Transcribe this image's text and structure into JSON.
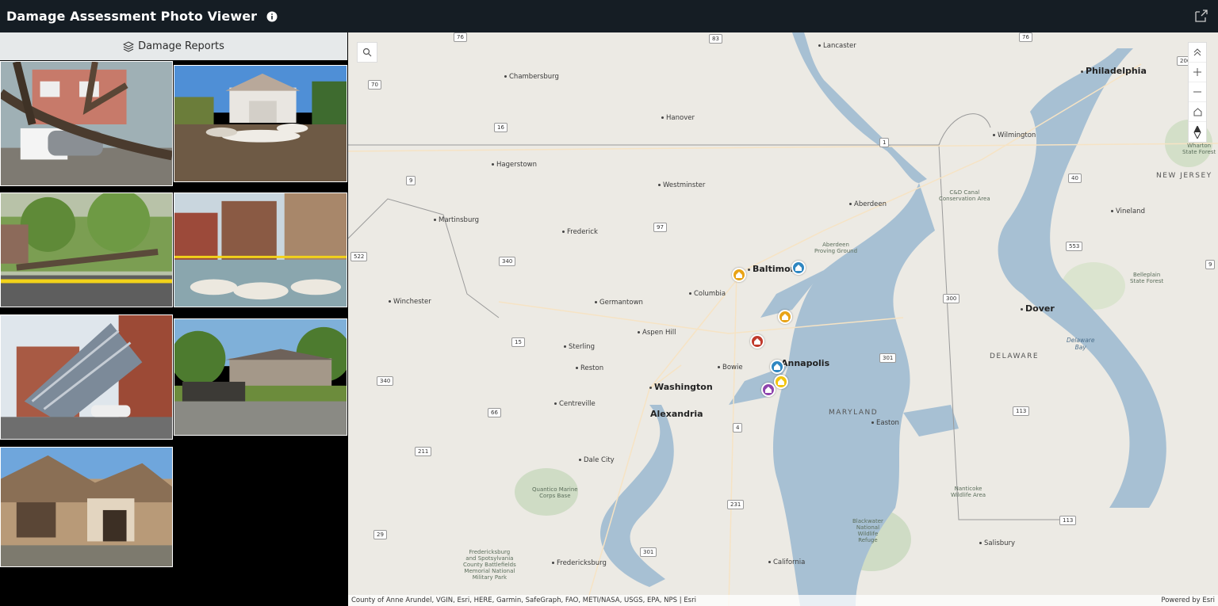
{
  "header": {
    "title": "Damage Assessment Photo Viewer"
  },
  "panel": {
    "title": "Damage Reports"
  },
  "gallery": {
    "photos": [
      {
        "subject": "fallen-tree-on-car"
      },
      {
        "subject": "sandbags-flood"
      },
      {
        "subject": "fallen-tree-street"
      },
      {
        "subject": "flooded-houses"
      },
      {
        "subject": "collapsed-roof"
      },
      {
        "subject": "debris-house"
      },
      {
        "subject": "destroyed-house"
      }
    ]
  },
  "map": {
    "places": {
      "lancaster": "Lancaster",
      "philadelphia": "Philadelphia",
      "chambersburg": "Chambersburg",
      "hanover": "Hanover",
      "wilmington": "Wilmington",
      "hagerstown": "Hagerstown",
      "westminster": "Westminster",
      "aberdeen": "Aberdeen",
      "martinsburg": "Martinsburg",
      "frederick": "Frederick",
      "vineland": "Vineland",
      "baltimore": "Baltimore",
      "columbia": "Columbia",
      "germantown": "Germantown",
      "winchester": "Winchester",
      "dover": "Dover",
      "aspen_hill": "Aspen Hill",
      "sterling": "Sterling",
      "reston": "Reston",
      "bowie": "Bowie",
      "annapolis": "Annapolis",
      "washington": "Washington",
      "alexandria": "Alexandria",
      "centreville": "Centreville",
      "easton": "Easton",
      "dale_city": "Dale City",
      "fredericksburg": "Fredericksburg",
      "california": "California",
      "salisbury": "Salisbury"
    },
    "states": {
      "new_jersey": "NEW JERSEY",
      "delaware": "DELAWARE",
      "maryland": "MARYLAND"
    },
    "parks": {
      "wharton": "Wharton\nState Forest",
      "cd_canal": "C&D Canal\nConservation Area",
      "aberdeen_pg": "Aberdeen\nProving Ground",
      "belleplain": "Belleplain\nState Forest",
      "quantico": "Quantico Marine\nCorps Base",
      "nanticoke": "Nanticoke\nWildlife Area",
      "blackwater": "Blackwater\nNational\nWildlife\nRefuge",
      "fredericksburg_park": "Fredericksburg\nand Spotsylvania\nCounty Battlefields\nMemorial National\nMilitary Park"
    },
    "water": {
      "delaware_bay": "Delaware\nBay"
    },
    "routes": [
      "76",
      "83",
      "76",
      "206",
      "70",
      "16",
      "1",
      "9",
      "40",
      "97",
      "522",
      "340",
      "553",
      "300",
      "15",
      "301",
      "340",
      "66",
      "113",
      "4",
      "211",
      "231",
      "113",
      "29",
      "301",
      "9"
    ],
    "markers": [
      {
        "name": "marker-baltimore-west",
        "color": "#e8a317"
      },
      {
        "name": "marker-baltimore-east",
        "color": "#2e86c1"
      },
      {
        "name": "marker-pasadena",
        "color": "#e8a317"
      },
      {
        "name": "marker-severna",
        "color": "#c0392b"
      },
      {
        "name": "marker-annapolis",
        "color": "#2e86c1"
      },
      {
        "name": "marker-edgewater",
        "color": "#f1c40f"
      },
      {
        "name": "marker-mayo",
        "color": "#8e44ad"
      }
    ],
    "attribution": "County of Anne Arundel, VGIN, Esri, HERE, Garmin, SafeGraph, FAO, METI/NASA, USGS, EPA, NPS | Esri",
    "powered_by": "Powered by Esri"
  }
}
